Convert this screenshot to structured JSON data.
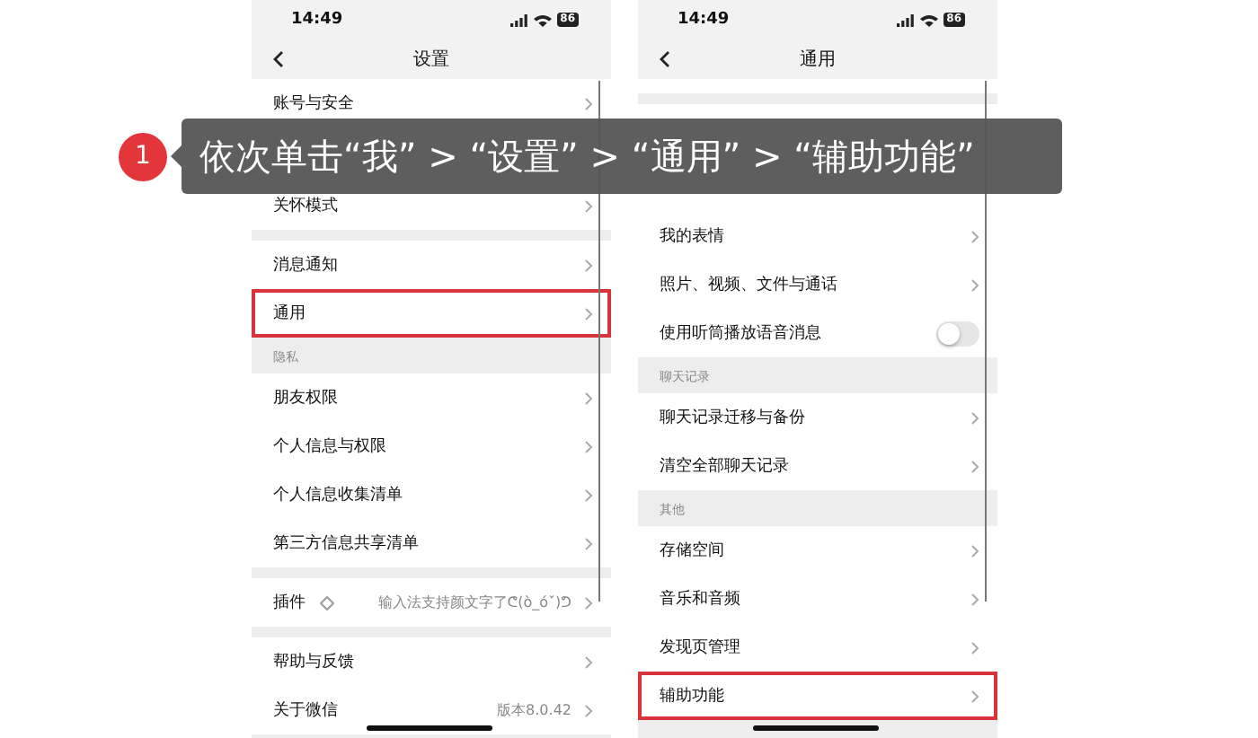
{
  "step": {
    "number": "1",
    "text": "依次单击“我” > “设置” > “通用” > “辅助功能”"
  },
  "screens": [
    {
      "time": "14:49",
      "battery": "86",
      "title": "设置",
      "items": [
        {
          "kind": "row",
          "label": "账号与安全",
          "highlighted": false
        },
        {
          "kind": "covered"
        },
        {
          "kind": "row",
          "label": "关怀模式",
          "highlighted": false
        },
        {
          "kind": "gap"
        },
        {
          "kind": "row",
          "label": "消息通知",
          "highlighted": false
        },
        {
          "kind": "row",
          "label": "通用",
          "highlighted": true
        },
        {
          "kind": "section",
          "label": "隐私"
        },
        {
          "kind": "row",
          "label": "朋友权限",
          "highlighted": false
        },
        {
          "kind": "row",
          "label": "个人信息与权限",
          "highlighted": false
        },
        {
          "kind": "row",
          "label": "个人信息收集清单",
          "highlighted": false
        },
        {
          "kind": "row",
          "label": "第三方信息共享清单",
          "highlighted": false
        },
        {
          "kind": "gap"
        },
        {
          "kind": "row",
          "label": "插件",
          "value": "输入法支持颜文字了ᕦ(ò_óˇ)ᕤ",
          "badge": true,
          "highlighted": false
        },
        {
          "kind": "gap"
        },
        {
          "kind": "row",
          "label": "帮助与反馈",
          "highlighted": false
        },
        {
          "kind": "row",
          "label": "关于微信",
          "value": "版本8.0.42",
          "highlighted": false
        }
      ]
    },
    {
      "time": "14:49",
      "battery": "86",
      "title": "通用",
      "items": [
        {
          "kind": "partial"
        },
        {
          "kind": "gap"
        },
        {
          "kind": "blank"
        },
        {
          "kind": "blank"
        },
        {
          "kind": "row",
          "label": "我的表情",
          "highlighted": false
        },
        {
          "kind": "row",
          "label": "照片、视频、文件与通话",
          "highlighted": false
        },
        {
          "kind": "toggle",
          "label": "使用听筒播放语音消息",
          "on": false
        },
        {
          "kind": "section",
          "label": "聊天记录"
        },
        {
          "kind": "row",
          "label": "聊天记录迁移与备份",
          "highlighted": false
        },
        {
          "kind": "row",
          "label": "清空全部聊天记录",
          "highlighted": false
        },
        {
          "kind": "section",
          "label": "其他"
        },
        {
          "kind": "row",
          "label": "存储空间",
          "highlighted": false
        },
        {
          "kind": "row",
          "label": "音乐和音频",
          "highlighted": false
        },
        {
          "kind": "row",
          "label": "发现页管理",
          "highlighted": false
        },
        {
          "kind": "row",
          "label": "辅助功能",
          "highlighted": true
        }
      ]
    }
  ]
}
